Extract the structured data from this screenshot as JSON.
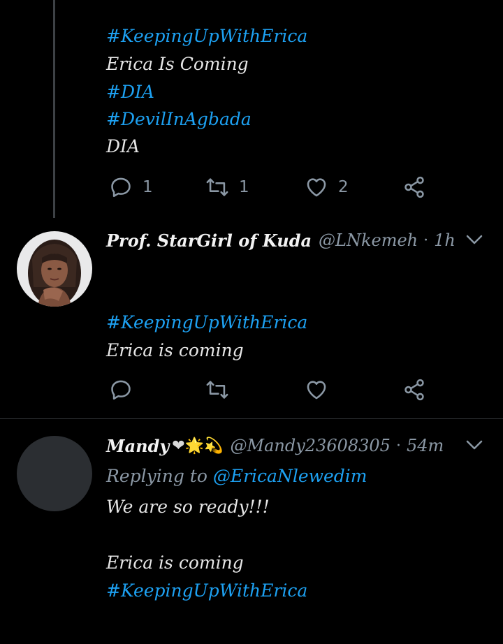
{
  "tweet1": {
    "lines": [
      {
        "text": "#KeepingUpWithErica",
        "type": "hashtag"
      },
      {
        "text": "Erica Is Coming",
        "type": "text"
      },
      {
        "text": "#DIA",
        "type": "hashtag"
      },
      {
        "text": "#DevilInAgbada",
        "type": "hashtag"
      },
      {
        "text": "DIA",
        "type": "text"
      }
    ],
    "reply_count": "1",
    "retweet_count": "1",
    "like_count": "2"
  },
  "tweet2": {
    "name": "Prof. StarGirl of Kuda",
    "handle": "@LNkemeh",
    "time": "1h",
    "lines": [
      {
        "text": "#KeepingUpWithErica",
        "type": "hashtag"
      },
      {
        "text": "Erica is coming",
        "type": "text"
      }
    ]
  },
  "tweet3": {
    "name": "Mandy",
    "emojis": "❤🌟💫",
    "handle": "@Mandy23608305",
    "time": "54m",
    "replying_prefix": "Replying to",
    "replying_handle": "@EricaNlewedim",
    "lines": [
      {
        "text": "We are so ready!!!",
        "type": "text"
      },
      {
        "text": "Erica is coming",
        "type": "text"
      },
      {
        "text": "#KeepingUpWithErica",
        "type": "hashtag"
      }
    ]
  },
  "colors": {
    "background": "#000000",
    "link": "#1da1f2",
    "muted": "#8b98a5",
    "text": "#e6e6e6"
  }
}
